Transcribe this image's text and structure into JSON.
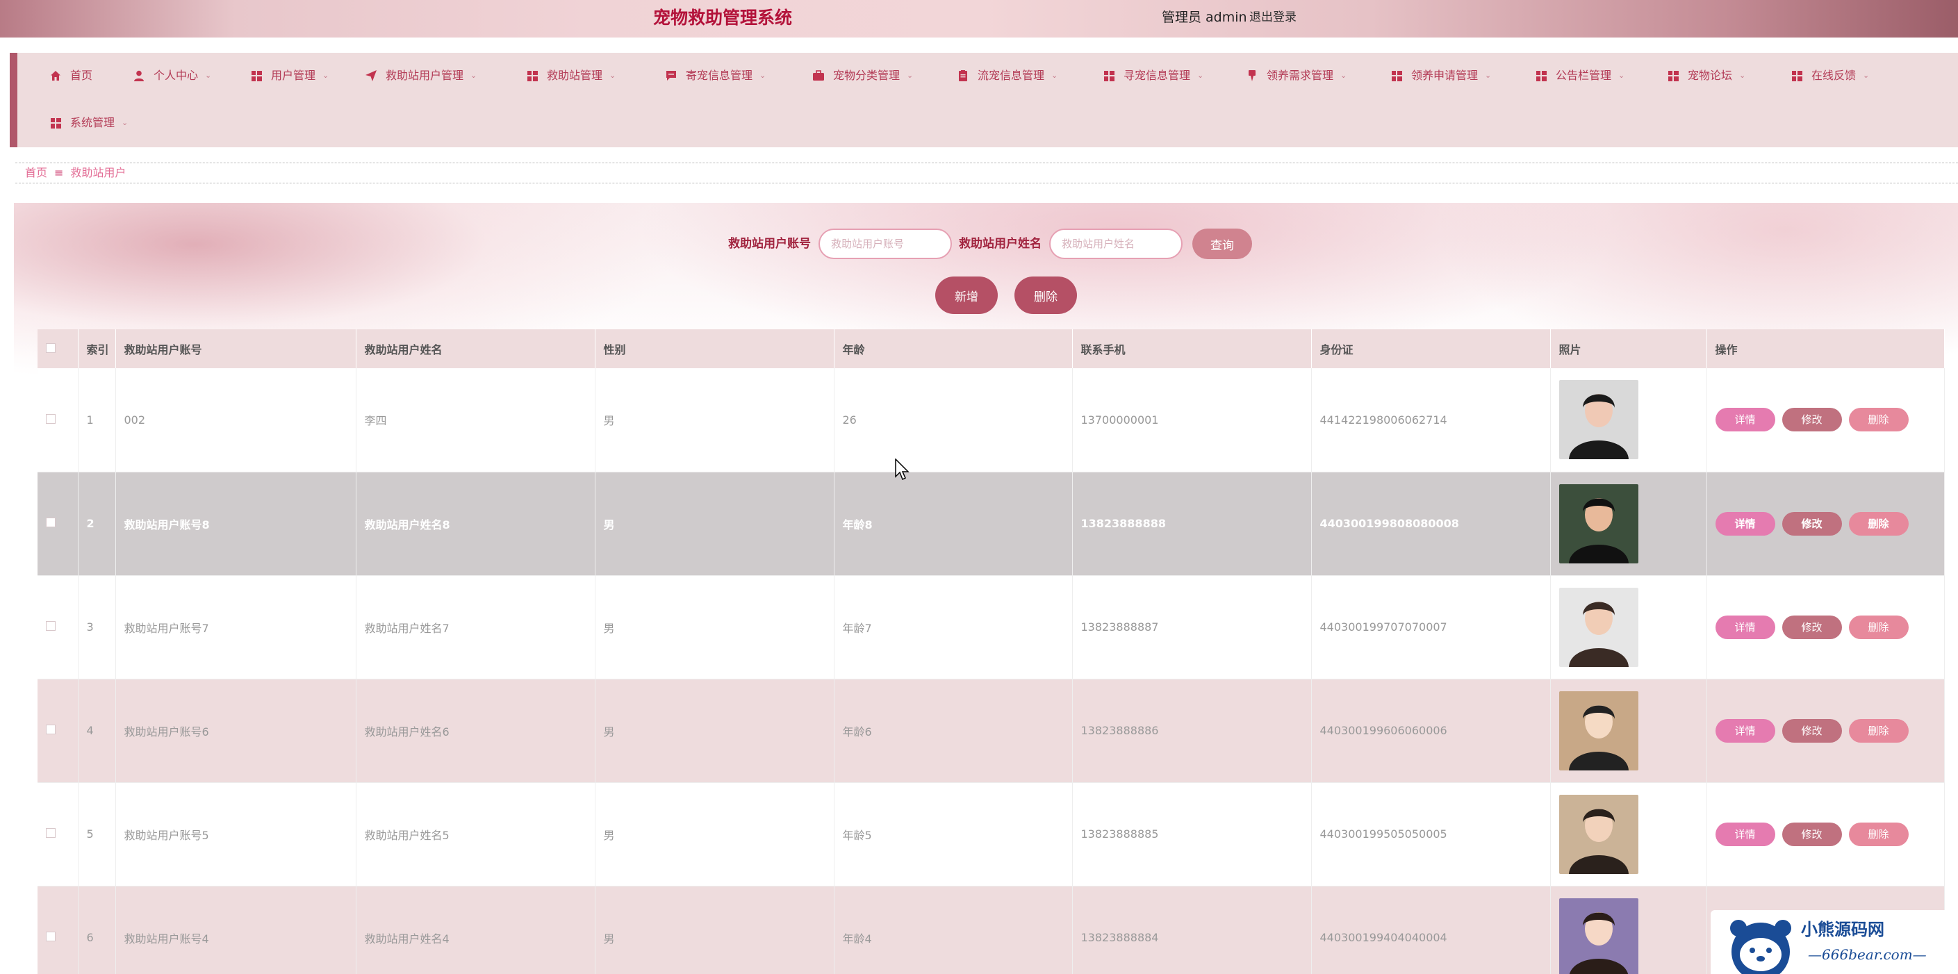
{
  "header": {
    "title": "宠物救助管理系统",
    "user_label": "管理员 admin",
    "logout": "退出登录"
  },
  "nav": {
    "items": [
      {
        "label": "首页",
        "icon": "home-icon"
      },
      {
        "label": "个人中心",
        "icon": "user-icon"
      },
      {
        "label": "用户管理",
        "icon": "grid-icon"
      },
      {
        "label": "救助站用户管理",
        "icon": "send-icon"
      },
      {
        "label": "救助站管理",
        "icon": "grid-icon"
      },
      {
        "label": "寄宠信息管理",
        "icon": "message-icon"
      },
      {
        "label": "宠物分类管理",
        "icon": "briefcase-icon"
      },
      {
        "label": "流宠信息管理",
        "icon": "clipboard-icon"
      },
      {
        "label": "寻宠信息管理",
        "icon": "grid-icon"
      },
      {
        "label": "领养需求管理",
        "icon": "pin-icon"
      },
      {
        "label": "领养申请管理",
        "icon": "grid-icon"
      },
      {
        "label": "公告栏管理",
        "icon": "grid-icon"
      },
      {
        "label": "宠物论坛",
        "icon": "grid-icon"
      },
      {
        "label": "在线反馈",
        "icon": "grid-icon"
      },
      {
        "label": "系统管理",
        "icon": "grid-icon"
      }
    ]
  },
  "breadcrumb": {
    "home": "首页",
    "separator": "≡",
    "current": "救助站用户"
  },
  "search": {
    "account_label": "救助站用户账号",
    "account_placeholder": "救助站用户账号",
    "name_label": "救助站用户姓名",
    "name_placeholder": "救助站用户姓名",
    "query_button": "查询"
  },
  "actions": {
    "add_button": "新增",
    "delete_button": "删除"
  },
  "table": {
    "headers": [
      "索引",
      "救助站用户账号",
      "救助站用户姓名",
      "性别",
      "年龄",
      "联系手机",
      "身份证",
      "照片",
      "操作"
    ],
    "row_buttons": {
      "detail": "详情",
      "edit": "修改",
      "delete": "删除"
    },
    "rows": [
      {
        "index": "1",
        "account": "002",
        "name": "李四",
        "gender": "男",
        "age": "26",
        "phone": "13700000001",
        "idcard": "441422198006062714"
      },
      {
        "index": "2",
        "account": "救助站用户账号8",
        "name": "救助站用户姓名8",
        "gender": "男",
        "age": "年龄8",
        "phone": "13823888888",
        "idcard": "440300199808080008"
      },
      {
        "index": "3",
        "account": "救助站用户账号7",
        "name": "救助站用户姓名7",
        "gender": "男",
        "age": "年龄7",
        "phone": "13823888887",
        "idcard": "440300199707070007"
      },
      {
        "index": "4",
        "account": "救助站用户账号6",
        "name": "救助站用户姓名6",
        "gender": "男",
        "age": "年龄6",
        "phone": "13823888886",
        "idcard": "440300199606060006"
      },
      {
        "index": "5",
        "account": "救助站用户账号5",
        "name": "救助站用户姓名5",
        "gender": "男",
        "age": "年龄5",
        "phone": "13823888885",
        "idcard": "440300199505050005"
      },
      {
        "index": "6",
        "account": "救助站用户账号4",
        "name": "救助站用户姓名4",
        "gender": "男",
        "age": "年龄4",
        "phone": "13823888884",
        "idcard": "440300199404040004"
      }
    ]
  },
  "watermark": {
    "title": "小熊源码网",
    "url": "—666bear.com—"
  },
  "colors": {
    "accent": "#b3123a",
    "nav_bg": "#eedcdd",
    "row_hover": "#cfcbcc",
    "btn_detail": "#e57bb0",
    "btn_edit": "#c0717f",
    "btn_delete": "#e7899c"
  }
}
